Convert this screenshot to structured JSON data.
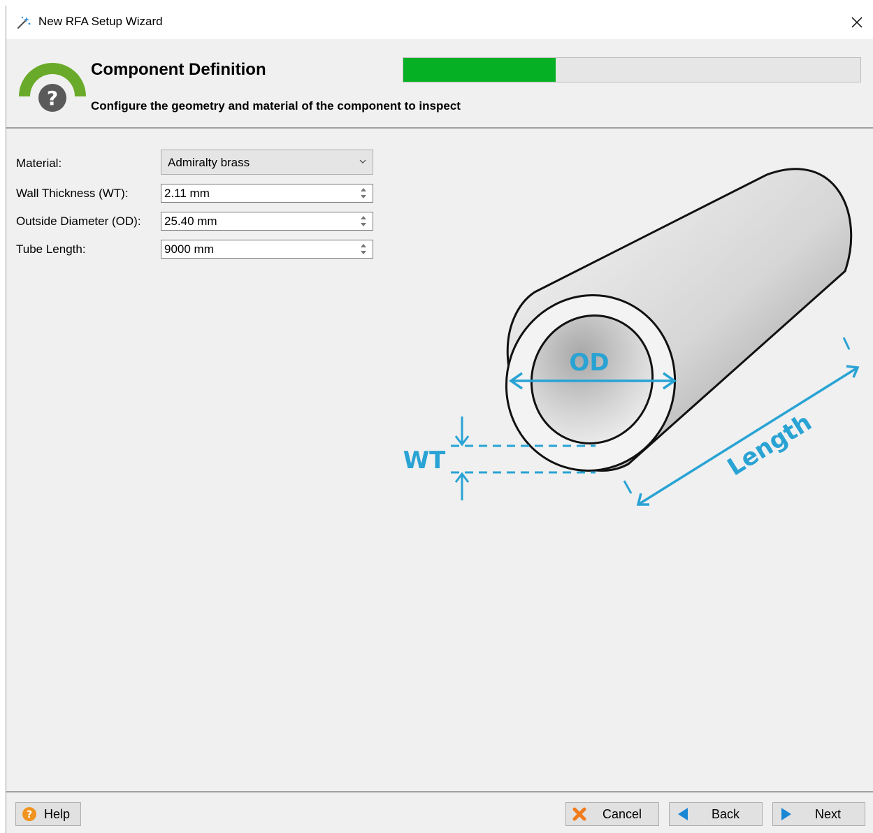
{
  "window": {
    "title": "New RFA Setup Wizard",
    "close_icon": "close-icon"
  },
  "header": {
    "title": "Component Definition",
    "subtitle": "Configure the geometry and material of the component to inspect",
    "progress_fraction": 0.333,
    "progress_color": "#06b025",
    "logo_color": "#6aaa2a"
  },
  "form": {
    "material": {
      "label": "Material:",
      "value": "Admiralty brass"
    },
    "wall_thickness": {
      "label": "Wall Thickness (WT):",
      "value": "2.11 mm"
    },
    "outside_diameter": {
      "label": "Outside Diameter (OD):",
      "value": "25.40 mm"
    },
    "tube_length": {
      "label": "Tube Length:",
      "value": "9000 mm"
    }
  },
  "diagram": {
    "od_label": "OD",
    "wt_label": "WT",
    "length_label": "Length",
    "dimension_color": "#29a3d4"
  },
  "footer": {
    "help_label": "Help",
    "cancel_label": "Cancel",
    "back_label": "Back",
    "next_label": "Next"
  }
}
